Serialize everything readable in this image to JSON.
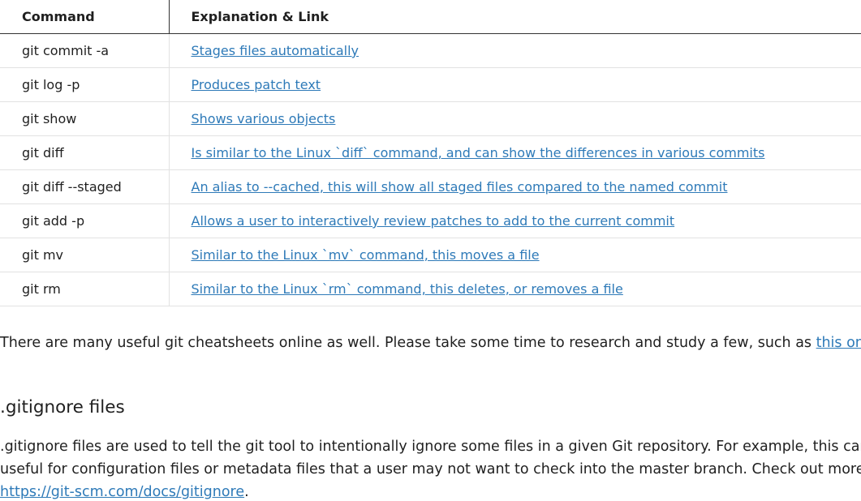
{
  "table": {
    "headers": {
      "command": "Command",
      "explanation": "Explanation & Link"
    },
    "rows": [
      {
        "command": "git commit -a",
        "explanation": "Stages files automatically"
      },
      {
        "command": "git log -p",
        "explanation": "Produces patch text"
      },
      {
        "command": "git show",
        "explanation": "Shows various objects"
      },
      {
        "command": "git diff",
        "explanation": "Is similar to the Linux `diff` command, and can show the differences in various commits"
      },
      {
        "command": "git diff --staged",
        "explanation": "An alias to --cached, this will show all staged files compared to the named commit"
      },
      {
        "command": "git add -p",
        "explanation": "Allows a user to interactively review patches to add to the current commit"
      },
      {
        "command": "git mv",
        "explanation": "Similar to the Linux `mv` command, this moves a file"
      },
      {
        "command": "git rm",
        "explanation": "Similar to the Linux `rm` command, this deletes, or removes a file"
      }
    ]
  },
  "note": {
    "text": "There are many useful git cheatsheets online as well. Please take some time to research and study a few, such as ",
    "link": "this one",
    "end": "."
  },
  "gitignore": {
    "heading": ".gitignore files",
    "line1": ".gitignore files are used to tell the git tool to intentionally ignore some files in a given Git repository. For example, this can be",
    "line2": "useful for configuration files or metadata files that a user may not want to check into the master branch. Check out more at",
    "link": "https://git-scm.com/docs/gitignore",
    "end": "."
  },
  "colors": {
    "link": "#2e7ab8",
    "text": "#1f1f1f",
    "header_border": "#333333",
    "row_border": "#e2e2e2"
  }
}
